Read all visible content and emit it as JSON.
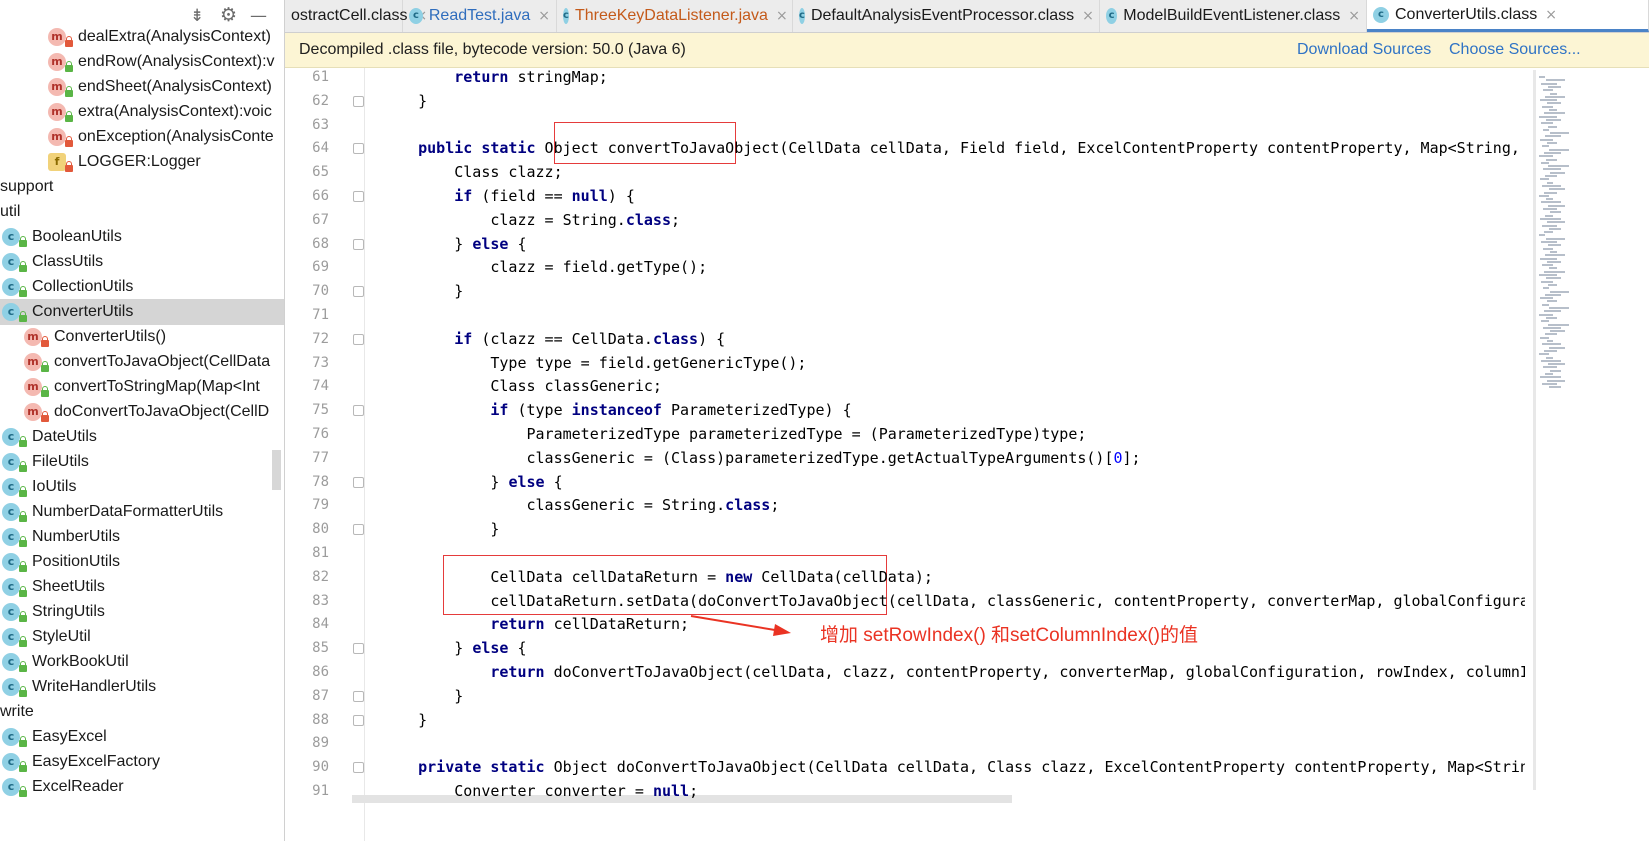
{
  "sidebar": {
    "toolbar_icons": [
      "collapse-icon",
      "gear-icon",
      "minimize-icon"
    ],
    "items": [
      {
        "label": "dealExtra(AnalysisContext)",
        "icon": "m",
        "lock": "red"
      },
      {
        "label": "endRow(AnalysisContext):v",
        "icon": "m",
        "lock": "green"
      },
      {
        "label": "endSheet(AnalysisContext)",
        "icon": "m",
        "lock": "green"
      },
      {
        "label": "extra(AnalysisContext):voic",
        "icon": "m",
        "lock": "green"
      },
      {
        "label": "onException(AnalysisConte",
        "icon": "m",
        "lock": "red"
      },
      {
        "label": "LOGGER:Logger",
        "icon": "f",
        "lock": "red"
      },
      {
        "label": "support",
        "icon": "",
        "lock": ""
      },
      {
        "label": "util",
        "icon": "",
        "lock": ""
      },
      {
        "label": "BooleanUtils",
        "icon": "c",
        "lock": "green"
      },
      {
        "label": "ClassUtils",
        "icon": "c",
        "lock": "green"
      },
      {
        "label": "CollectionUtils",
        "icon": "c",
        "lock": "green"
      },
      {
        "label": "ConverterUtils",
        "icon": "c",
        "lock": "green"
      },
      {
        "label": "ConverterUtils()",
        "icon": "m",
        "lock": "red"
      },
      {
        "label": "convertToJavaObject(CellData",
        "icon": "m",
        "lock": "green"
      },
      {
        "label": "convertToStringMap(Map<Int",
        "icon": "m",
        "lock": "green"
      },
      {
        "label": "doConvertToJavaObject(CellD",
        "icon": "m",
        "lock": "red"
      },
      {
        "label": "DateUtils",
        "icon": "c",
        "lock": "green"
      },
      {
        "label": "FileUtils",
        "icon": "c",
        "lock": "green"
      },
      {
        "label": "IoUtils",
        "icon": "c",
        "lock": "green"
      },
      {
        "label": "NumberDataFormatterUtils",
        "icon": "c",
        "lock": "green"
      },
      {
        "label": "NumberUtils",
        "icon": "c",
        "lock": "green"
      },
      {
        "label": "PositionUtils",
        "icon": "c",
        "lock": "green"
      },
      {
        "label": "SheetUtils",
        "icon": "c",
        "lock": "green"
      },
      {
        "label": "StringUtils",
        "icon": "c",
        "lock": "green"
      },
      {
        "label": "StyleUtil",
        "icon": "c",
        "lock": "green"
      },
      {
        "label": "WorkBookUtil",
        "icon": "c",
        "lock": "green"
      },
      {
        "label": "WriteHandlerUtils",
        "icon": "c",
        "lock": "green"
      },
      {
        "label": "write",
        "icon": "",
        "lock": ""
      },
      {
        "label": "EasyExcel",
        "icon": "c",
        "lock": "green"
      },
      {
        "label": "EasyExcelFactory",
        "icon": "c",
        "lock": "green"
      },
      {
        "label": "ExcelReader",
        "icon": "c",
        "lock": "green"
      }
    ]
  },
  "tabs": [
    {
      "label": "ostractCell.class",
      "color": "#1a1a1a",
      "icon": ""
    },
    {
      "label": "ReadTest.java",
      "color": "#2f6dbd",
      "icon": "c"
    },
    {
      "label": "ThreeKeyDataListener.java",
      "color": "#c45a1a",
      "icon": "c"
    },
    {
      "label": "DefaultAnalysisEventProcessor.class",
      "color": "#1a1a1a",
      "icon": "c"
    },
    {
      "label": "ModelBuildEventListener.class",
      "color": "#1a1a1a",
      "icon": "c"
    },
    {
      "label": "ConverterUtils.class",
      "color": "#1a1a1a",
      "icon": "c"
    }
  ],
  "banner": {
    "message": "Decompiled .class file, bytecode version: 50.0 (Java 6)",
    "download_sources": "Download Sources",
    "choose_sources": "Choose Sources..."
  },
  "code_lines": [
    {
      "n": "61",
      "t": "        return stringMap;"
    },
    {
      "n": "62",
      "t": "    }"
    },
    {
      "n": "63",
      "t": ""
    },
    {
      "n": "64",
      "t": "    public static Object convertToJavaObject(CellData cellData, Field field, ExcelContentProperty contentProperty, Map<String, Converter>"
    },
    {
      "n": "65",
      "t": "        Class clazz;"
    },
    {
      "n": "66",
      "t": "        if (field == null) {"
    },
    {
      "n": "67",
      "t": "            clazz = String.class;"
    },
    {
      "n": "68",
      "t": "        } else {"
    },
    {
      "n": "69",
      "t": "            clazz = field.getType();"
    },
    {
      "n": "70",
      "t": "        }"
    },
    {
      "n": "71",
      "t": ""
    },
    {
      "n": "72",
      "t": "        if (clazz == CellData.class) {"
    },
    {
      "n": "73",
      "t": "            Type type = field.getGenericType();"
    },
    {
      "n": "74",
      "t": "            Class classGeneric;"
    },
    {
      "n": "75",
      "t": "            if (type instanceof ParameterizedType) {"
    },
    {
      "n": "76",
      "t": "                ParameterizedType parameterizedType = (ParameterizedType)type;"
    },
    {
      "n": "77",
      "t": "                classGeneric = (Class)parameterizedType.getActualTypeArguments()[0];"
    },
    {
      "n": "78",
      "t": "            } else {"
    },
    {
      "n": "79",
      "t": "                classGeneric = String.class;"
    },
    {
      "n": "80",
      "t": "            }"
    },
    {
      "n": "81",
      "t": ""
    },
    {
      "n": "82",
      "t": "            CellData cellDataReturn = new CellData(cellData);"
    },
    {
      "n": "83",
      "t": "            cellDataReturn.setData(doConvertToJavaObject(cellData, classGeneric, contentProperty, converterMap, globalConfiguration, rowIn"
    },
    {
      "n": "84",
      "t": "            return cellDataReturn;"
    },
    {
      "n": "85",
      "t": "        } else {"
    },
    {
      "n": "86",
      "t": "            return doConvertToJavaObject(cellData, clazz, contentProperty, converterMap, globalConfiguration, rowIndex, columnIndex);"
    },
    {
      "n": "87",
      "t": "        }"
    },
    {
      "n": "88",
      "t": "    }"
    },
    {
      "n": "89",
      "t": ""
    },
    {
      "n": "90",
      "t": "    private static Object doConvertToJavaObject(CellData cellData, Class clazz, ExcelContentProperty contentProperty, Map<String, Converte"
    },
    {
      "n": "91",
      "t": "        Converter converter = null;"
    }
  ],
  "annotation": {
    "note": "增加 setRowIndex() 和setColumnIndex()的值",
    "color": "#ea3323"
  }
}
